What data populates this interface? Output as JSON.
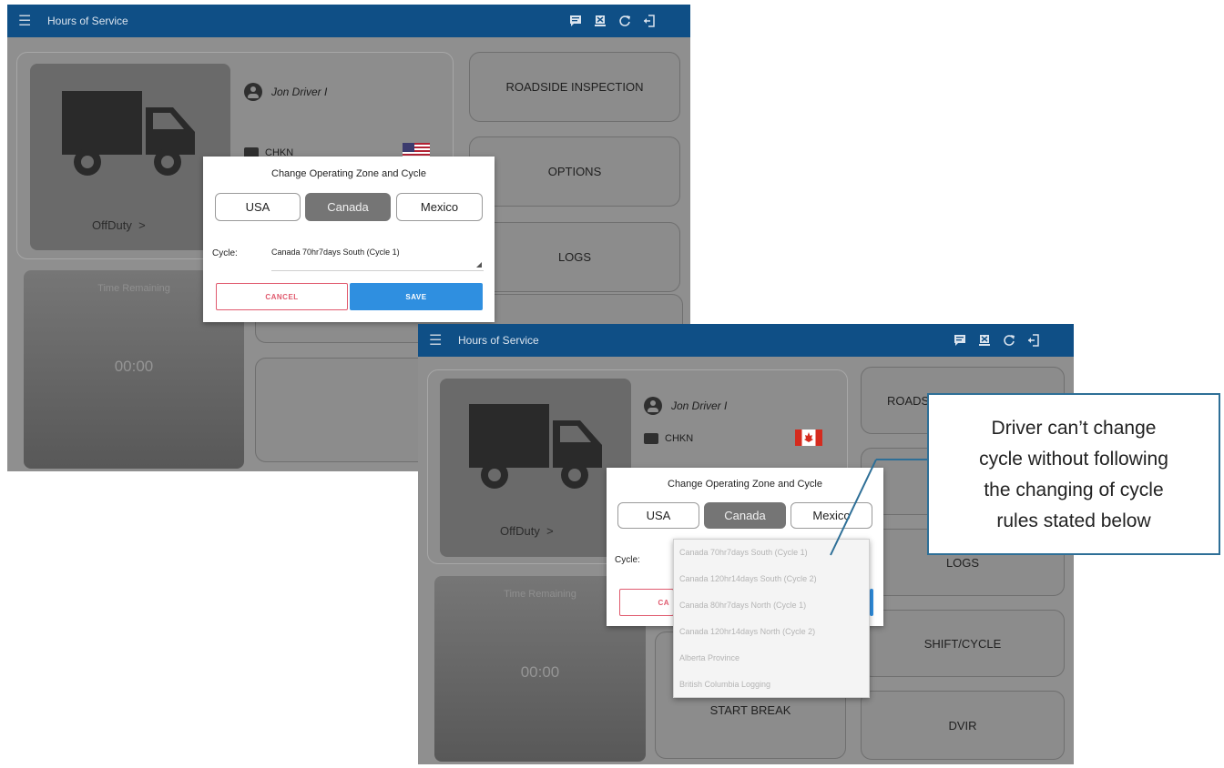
{
  "app": {
    "title": "Hours of Service",
    "header_color": "#0f4f86",
    "header_icons": [
      "message-icon",
      "eld-icon",
      "refresh-icon",
      "logout-icon"
    ]
  },
  "driver": {
    "name": "Jon Driver I",
    "vehicle": "CHKN",
    "duty_status": "OffDuty",
    "time_remaining_label": "Time Remaining",
    "time_remaining": "00:00"
  },
  "buttons": {
    "roadside_inspection": "ROADSIDE INSPECTION",
    "roadside_inspection_partial": "ROADS",
    "options": "OPTIONS",
    "logs": "LOGS",
    "start_break": "START BREAK",
    "shift_cycle": "SHIFT/CYCLE",
    "dvir": "DVIR"
  },
  "dialog": {
    "title": "Change Operating Zone and Cycle",
    "zones": [
      "USA",
      "Canada",
      "Mexico"
    ],
    "selected_zone": "Canada",
    "cycle_label": "Cycle:",
    "cycle_value": "Canada 70hr7days South (Cycle 1)",
    "cancel": "CANCEL",
    "cancel_partial": "CA",
    "save": "SAVE",
    "cancel_color": "#e05a6e",
    "save_color": "#2f8fe0"
  },
  "cycle_options": [
    "Canada 70hr7days South (Cycle 1)",
    "Canada 120hr14days South (Cycle 2)",
    "Canada 80hr7days North (Cycle 1)",
    "Canada 120hr14days North (Cycle 2)",
    "Alberta Province",
    "British Columbia Logging"
  ],
  "callout": {
    "text": "Driver can’t change\ncycle without following\nthe changing of cycle\nrules stated below",
    "border_color": "#2e6f97"
  }
}
